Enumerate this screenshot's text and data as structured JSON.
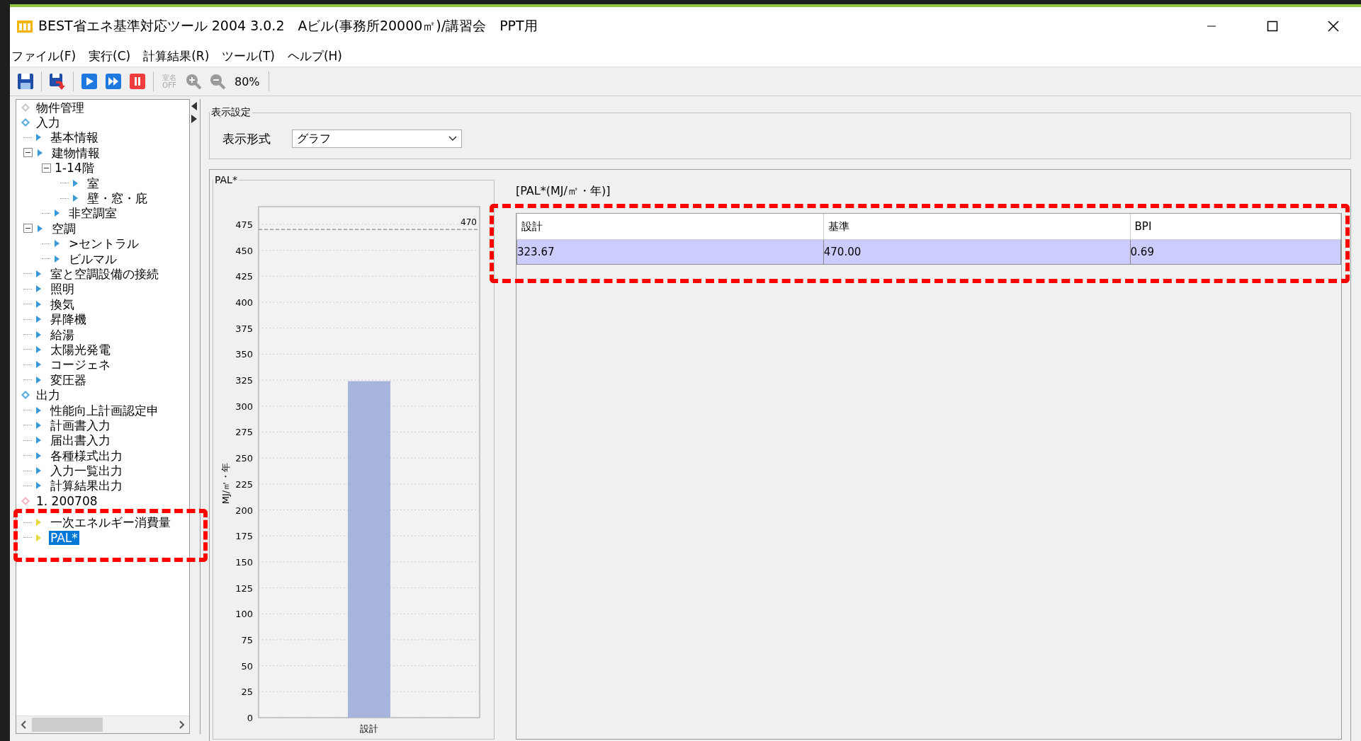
{
  "window": {
    "title": "BEST省エネ基準対応ツール 2004 3.0.2　Aビル(事務所20000㎡)/講習会　PPT用"
  },
  "menu": [
    "ファイル(F)",
    "実行(C)",
    "計算結果(R)",
    "ツール(T)",
    "ヘルプ(H)"
  ],
  "toolbar": {
    "room_name_toggle": [
      "室名",
      "OFF"
    ],
    "zoom": "80%"
  },
  "tree": [
    {
      "label": "物件管理",
      "kind": "root",
      "color": "#c8c8c8",
      "selected": false
    },
    {
      "label": "入力",
      "kind": "root",
      "color": "#5aaee0",
      "selected": false,
      "children": [
        {
          "label": "基本情報",
          "kind": "node",
          "color": "#3a9ad9",
          "selected": false
        },
        {
          "label": "建物情報",
          "kind": "node",
          "color": "#3a9ad9",
          "selected": false,
          "expanded": true,
          "children": [
            {
              "label": "1-14階",
              "kind": "folder",
              "selected": false,
              "expanded": true,
              "children": [
                {
                  "label": "室",
                  "kind": "node",
                  "color": "#3a9ad9",
                  "selected": false
                },
                {
                  "label": "壁・窓・庇",
                  "kind": "node",
                  "color": "#3a9ad9",
                  "selected": false
                }
              ]
            },
            {
              "label": "非空調室",
              "kind": "node",
              "color": "#3a9ad9",
              "selected": false
            }
          ]
        },
        {
          "label": "空調",
          "kind": "node",
          "color": "#3a9ad9",
          "selected": false,
          "expanded": true,
          "children": [
            {
              "label": ">セントラル",
              "kind": "node",
              "color": "#3a9ad9",
              "selected": false
            },
            {
              "label": "ビルマル",
              "kind": "node",
              "color": "#3a9ad9",
              "selected": false
            }
          ]
        },
        {
          "label": "室と空調設備の接続",
          "kind": "node",
          "color": "#3a9ad9",
          "selected": false
        },
        {
          "label": "照明",
          "kind": "node",
          "color": "#3a9ad9",
          "selected": false
        },
        {
          "label": "換気",
          "kind": "node",
          "color": "#3a9ad9",
          "selected": false
        },
        {
          "label": "昇降機",
          "kind": "node",
          "color": "#3a9ad9",
          "selected": false
        },
        {
          "label": "給湯",
          "kind": "node",
          "color": "#3a9ad9",
          "selected": false
        },
        {
          "label": "太陽光発電",
          "kind": "node",
          "color": "#3a9ad9",
          "selected": false
        },
        {
          "label": "コージェネ",
          "kind": "node",
          "color": "#3a9ad9",
          "selected": false
        },
        {
          "label": "変圧器",
          "kind": "node",
          "color": "#3a9ad9",
          "selected": false
        }
      ]
    },
    {
      "label": "出力",
      "kind": "root",
      "color": "#5aaee0",
      "selected": false,
      "children": [
        {
          "label": "性能向上計画認定申",
          "kind": "node",
          "color": "#3a9ad9",
          "selected": false
        },
        {
          "label": "計画書入力",
          "kind": "node",
          "color": "#3a9ad9",
          "selected": false
        },
        {
          "label": "届出書入力",
          "kind": "node",
          "color": "#3a9ad9",
          "selected": false
        },
        {
          "label": "各種様式出力",
          "kind": "node",
          "color": "#3a9ad9",
          "selected": false
        },
        {
          "label": "入力一覧出力",
          "kind": "node",
          "color": "#3a9ad9",
          "selected": false
        },
        {
          "label": "計算結果出力",
          "kind": "node",
          "color": "#3a9ad9",
          "selected": false
        }
      ]
    },
    {
      "label": "1. 200708",
      "kind": "root",
      "color": "#f2b8c6",
      "selected": false,
      "highlighted": true,
      "children": [
        {
          "label": "一次エネルギー消費量",
          "kind": "node",
          "color": "#e6d83a",
          "selected": false
        },
        {
          "label": "PAL*",
          "kind": "node",
          "color": "#e6d83a",
          "selected": true
        }
      ]
    }
  ],
  "display_settings": {
    "title": "表示設定",
    "label": "表示形式",
    "value": "グラフ"
  },
  "chart_panel": {
    "title": "PAL*",
    "chart_data": {
      "type": "bar",
      "ylabel": "MJ/㎡・年",
      "categories": [
        "設計"
      ],
      "series": [
        {
          "color": "#a7b4db",
          "values": [
            324
          ]
        }
      ],
      "ylim": [
        0,
        492
      ],
      "yticks": [
        0,
        25,
        50,
        75,
        100,
        125,
        150,
        175,
        200,
        225,
        250,
        275,
        300,
        325,
        350,
        375,
        400,
        425,
        450,
        475
      ],
      "grid": true,
      "ref_lines": [
        {
          "axis": "y",
          "value": 470,
          "label": "470"
        }
      ]
    }
  },
  "result_table": {
    "caption": "[PAL*(MJ/㎡・年)]",
    "highlighted": true,
    "columns": [
      "設計",
      "基準",
      "BPI"
    ],
    "rows": [
      {
        "cells": [
          "323.67",
          "470.00",
          "0.69"
        ],
        "selected": true
      }
    ]
  }
}
